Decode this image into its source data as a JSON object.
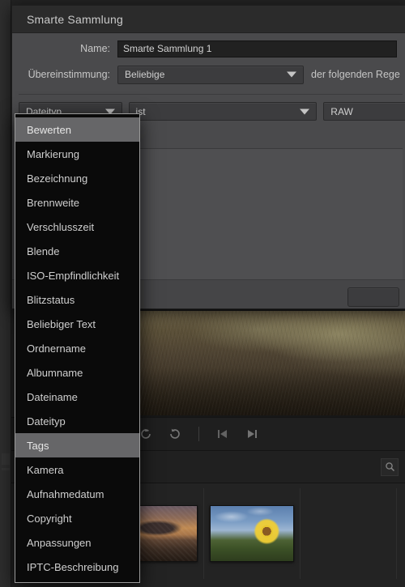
{
  "background_app": {
    "toolbar": {
      "icons": [
        {
          "name": "rotate-left-icon",
          "glyph": "↺"
        },
        {
          "name": "rotate-right-icon",
          "glyph": "↻"
        },
        {
          "name": "previous-image-icon",
          "glyph": "|◀"
        },
        {
          "name": "next-image-icon",
          "glyph": "▶|"
        }
      ]
    },
    "search": {
      "icon": "search-icon",
      "glyph": "⌕"
    },
    "filmstrip": {
      "thumbnails": [
        {
          "name": "thumbnail-portrait",
          "style": "portrait"
        },
        {
          "name": "thumbnail-sunset",
          "style": "sunset"
        },
        {
          "name": "thumbnail-sunflower",
          "style": "flower"
        }
      ]
    },
    "main_photo": {
      "name": "main-photo-dune-grass"
    }
  },
  "dialog": {
    "title": "Smarte Sammlung",
    "fields": {
      "name_label": "Name:",
      "name_value": "Smarte Sammlung 1",
      "name_placeholder": "Smarte Sammlung 1",
      "match_label": "Übereinstimmung:",
      "match_value": "Beliebige",
      "rule_suffix": "der folgenden Rege"
    },
    "rule": {
      "field_value": "Dateityp",
      "operator_value": "ist",
      "value_value": "RAW"
    },
    "footer": {
      "primary_button": ""
    }
  },
  "dropdown_menu": {
    "open": true,
    "selected_index": 13,
    "hover_index": 0,
    "items": [
      {
        "label": "Bewerten"
      },
      {
        "label": "Markierung"
      },
      {
        "label": "Bezeichnung"
      },
      {
        "label": "Brennweite"
      },
      {
        "label": "Verschlusszeit"
      },
      {
        "label": "Blende"
      },
      {
        "label": "ISO-Empfindlichkeit"
      },
      {
        "label": "Blitzstatus"
      },
      {
        "label": "Beliebiger Text"
      },
      {
        "label": "Ordnername"
      },
      {
        "label": "Albumname"
      },
      {
        "label": "Dateiname"
      },
      {
        "label": "Dateityp"
      },
      {
        "label": "Tags"
      },
      {
        "label": "Kamera"
      },
      {
        "label": "Aufnahmedatum"
      },
      {
        "label": "Copyright"
      },
      {
        "label": "Anpassungen"
      },
      {
        "label": "IPTC-Beschreibung"
      }
    ]
  },
  "colors": {
    "dialog_bg": "#4a4a4c",
    "titlebar_bg": "#2b2b2b",
    "menu_bg": "#0a0a0a",
    "menu_border": "#9a9a9a",
    "menu_highlight": "#666668",
    "text": "#cfcfcf",
    "app_bg": "#232323"
  }
}
